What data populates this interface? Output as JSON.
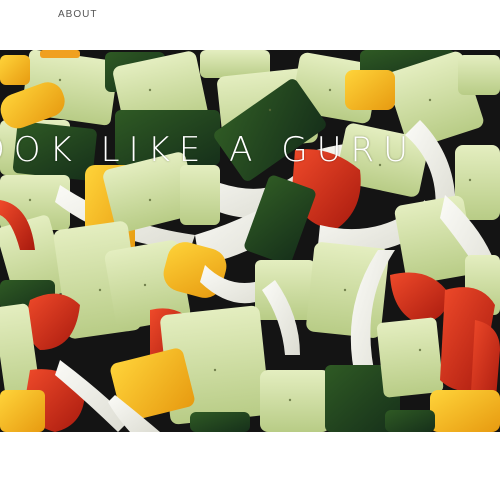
{
  "nav": {
    "about_label": "ABOUT"
  },
  "hero": {
    "title": "OOK LIKE A GURU",
    "image_icon": "roasted-vegetables-photo"
  },
  "colors": {
    "background": "#ffffff",
    "nav_text": "#555555",
    "title_text": "#ffffff"
  }
}
